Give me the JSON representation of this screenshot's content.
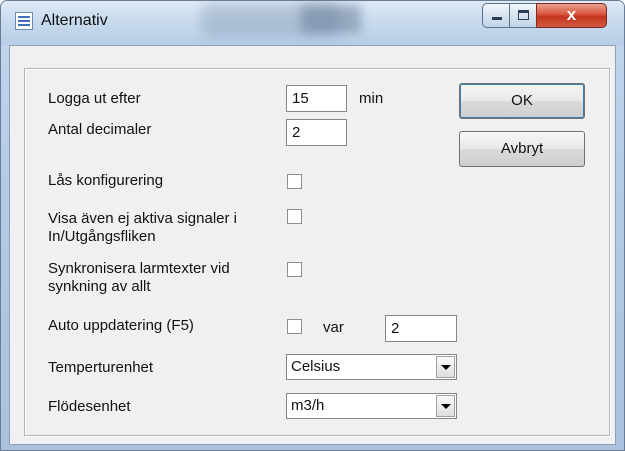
{
  "window": {
    "title": "Alternativ",
    "close_glyph": "x",
    "icons": {
      "app": "options-window-icon",
      "minimize": "minimize-icon",
      "maximize": "maximize-icon",
      "close": "close-icon"
    }
  },
  "form": {
    "logout": {
      "label": "Logga ut efter",
      "value": "15",
      "unit": "min"
    },
    "decimals": {
      "label": "Antal decimaler",
      "value": "2"
    },
    "lock_config": {
      "label": "Lås konfigurering",
      "checked": false
    },
    "show_inactive": {
      "label_line1": "Visa även ej aktiva signaler i",
      "label_line2": "In/Utgångsfliken",
      "checked": false
    },
    "sync_alarms": {
      "label_line1": "Synkronisera larmtexter vid",
      "label_line2": "synkning av allt",
      "checked": false
    },
    "auto_update": {
      "label": "Auto uppdatering (F5)",
      "checked": false,
      "every_label": "var",
      "value": "2"
    },
    "temperature_unit": {
      "label": "Temperturenhet",
      "selected": "Celsius"
    },
    "flow_unit": {
      "label": "Flödesenhet",
      "selected": "m3/h"
    }
  },
  "buttons": {
    "ok": "OK",
    "cancel": "Avbryt"
  }
}
